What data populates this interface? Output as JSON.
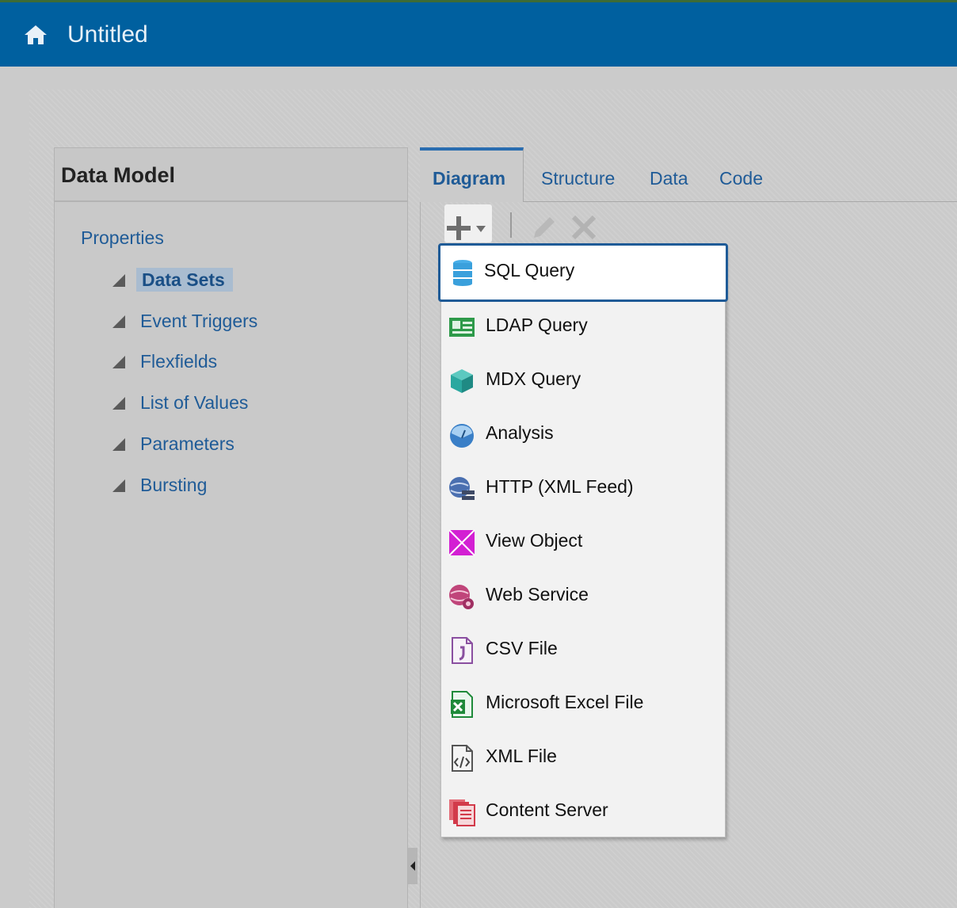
{
  "app": {
    "title": "Untitled",
    "home_icon": "home-icon"
  },
  "left_panel": {
    "title": "Data Model",
    "properties_label": "Properties",
    "items": [
      {
        "label": "Data Sets",
        "selected": true
      },
      {
        "label": "Event Triggers"
      },
      {
        "label": "Flexfields"
      },
      {
        "label": "List of Values"
      },
      {
        "label": "Parameters"
      },
      {
        "label": "Bursting"
      }
    ]
  },
  "tabs": [
    {
      "label": "Diagram",
      "active": true
    },
    {
      "label": "Structure"
    },
    {
      "label": "Data"
    },
    {
      "label": "Code"
    }
  ],
  "toolbar": {
    "add_icon": "plus-dropdown-icon",
    "edit_icon": "pencil-icon",
    "delete_icon": "close-icon"
  },
  "menu": {
    "items": [
      {
        "label": "SQL Query",
        "icon": "database-icon",
        "color": "#3aa0dc"
      },
      {
        "label": "LDAP Query",
        "icon": "ldap-card-icon",
        "color": "#2e9a4a"
      },
      {
        "label": "MDX Query",
        "icon": "cube-icon",
        "color": "#2aa8a0"
      },
      {
        "label": "Analysis",
        "icon": "analysis-icon",
        "color": "#3a7fc7"
      },
      {
        "label": "HTTP (XML Feed)",
        "icon": "globe-server-icon",
        "color": "#4a5f8c"
      },
      {
        "label": "View Object",
        "icon": "view-object-icon",
        "color": "#d31fd3"
      },
      {
        "label": "Web Service",
        "icon": "globe-gear-icon",
        "color": "#c0457a"
      },
      {
        "label": "CSV File",
        "icon": "csv-file-icon",
        "color": "#8a4fa0"
      },
      {
        "label": "Microsoft Excel File",
        "icon": "excel-file-icon",
        "color": "#1f8a3a"
      },
      {
        "label": "XML File",
        "icon": "xml-file-icon",
        "color": "#555555"
      },
      {
        "label": "Content Server",
        "icon": "content-server-icon",
        "color": "#d23a4a"
      }
    ]
  }
}
